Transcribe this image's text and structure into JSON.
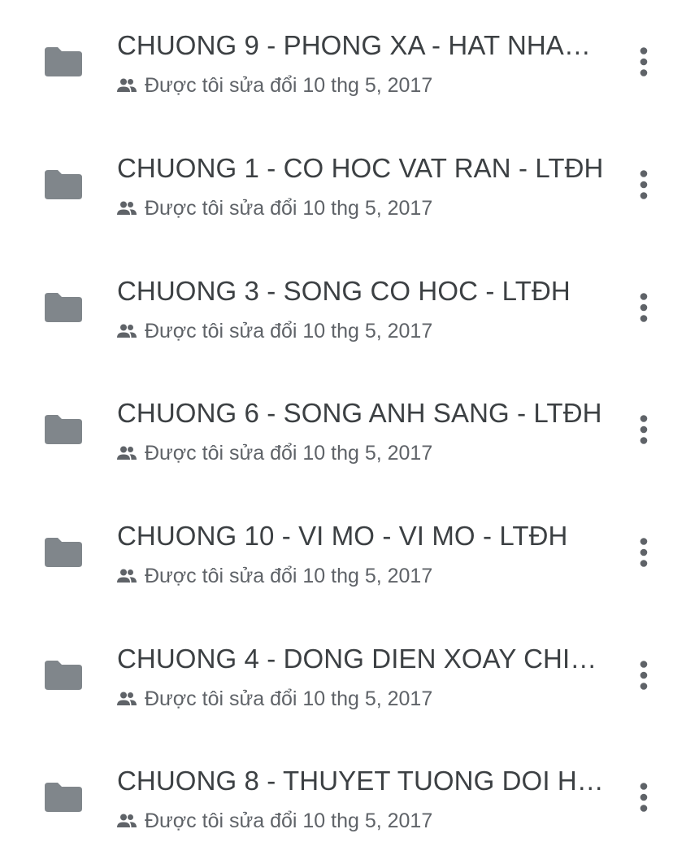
{
  "colors": {
    "folder": "#80868b",
    "title_text": "#3c4043",
    "meta_text": "#5f6368",
    "icon": "#5f6368"
  },
  "icons": {
    "folder": "folder-icon",
    "shared": "shared-people-icon",
    "more": "more-vert-icon"
  },
  "items": [
    {
      "name": "CHUONG 9 - PHONG XA - HAT NHAN ...",
      "modified": "Được tôi sửa đổi 10 thg 5, 2017"
    },
    {
      "name": "CHUONG 1 - CO HOC VAT RAN - LTĐH",
      "modified": "Được tôi sửa đổi 10 thg 5, 2017"
    },
    {
      "name": "CHUONG 3 - SONG CO HOC - LTĐH",
      "modified": "Được tôi sửa đổi 10 thg 5, 2017"
    },
    {
      "name": "CHUONG 6 - SONG ANH SANG - LTĐH",
      "modified": "Được tôi sửa đổi 10 thg 5, 2017"
    },
    {
      "name": "CHUONG 10 - VI MO - VI MO - LTĐH",
      "modified": "Được tôi sửa đổi 10 thg 5, 2017"
    },
    {
      "name": "CHUONG 4 - DONG DIEN XOAY CHIEU...",
      "modified": "Được tôi sửa đổi 10 thg 5, 2017"
    },
    {
      "name": "CHUONG 8 - THUYET TUONG DOI HE...",
      "modified": "Được tôi sửa đổi 10 thg 5, 2017"
    }
  ]
}
